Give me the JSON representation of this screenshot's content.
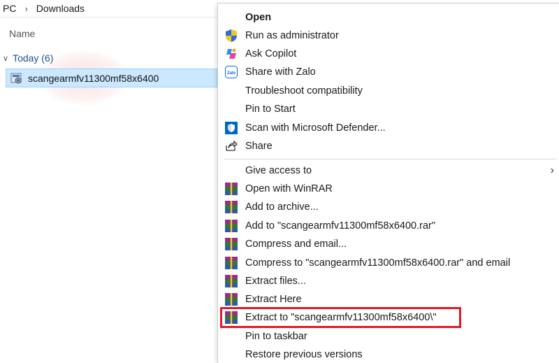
{
  "explorer": {
    "breadcrumb": [
      "PC",
      "Downloads"
    ],
    "column_header": "Name",
    "group_label": "Today (6)",
    "selected_file": "scangearmfv11300mf58x6400"
  },
  "context_menu": {
    "items": [
      {
        "label": "Open",
        "icon": "none"
      },
      {
        "label": "Run as administrator",
        "icon": "uac-shield-icon"
      },
      {
        "label": "Ask Copilot",
        "icon": "copilot-icon"
      },
      {
        "label": "Share with Zalo",
        "icon": "zalo-icon"
      },
      {
        "label": "Troubleshoot compatibility",
        "icon": "none"
      },
      {
        "label": "Pin to Start",
        "icon": "none"
      },
      {
        "label": "Scan with Microsoft Defender...",
        "icon": "defender-icon"
      },
      {
        "label": "Share",
        "icon": "share-icon"
      },
      {
        "label": "Give access to",
        "icon": "none"
      },
      {
        "label": "Open with WinRAR",
        "icon": "winrar-icon"
      },
      {
        "label": "Add to archive...",
        "icon": "winrar-icon"
      },
      {
        "label": "Add to \"scangearmfv11300mf58x6400.rar\"",
        "icon": "winrar-icon"
      },
      {
        "label": "Compress and email...",
        "icon": "winrar-icon"
      },
      {
        "label": "Compress to \"scangearmfv11300mf58x6400.rar\" and email",
        "icon": "winrar-icon"
      },
      {
        "label": "Extract files...",
        "icon": "winrar-icon"
      },
      {
        "label": "Extract Here",
        "icon": "winrar-icon"
      },
      {
        "label": "Extract to \"scangearmfv11300mf58x6400\\\"",
        "icon": "winrar-icon"
      },
      {
        "label": "Pin to taskbar",
        "icon": "none"
      },
      {
        "label": "Restore previous versions",
        "icon": "none"
      }
    ],
    "submenu_arrow": "›",
    "highlight_color": "#e01b24"
  }
}
